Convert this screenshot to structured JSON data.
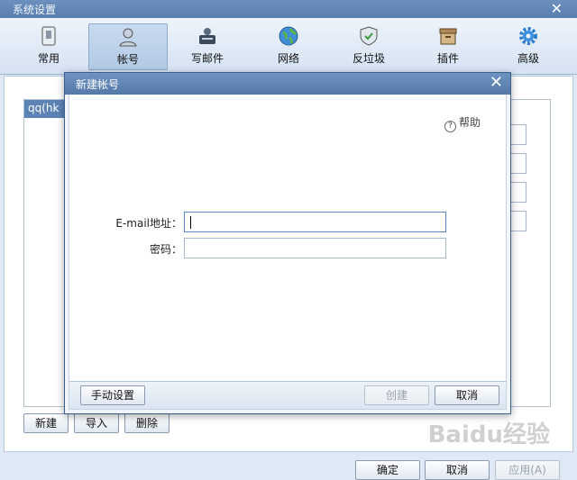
{
  "window": {
    "title": "系统设置",
    "close_symbol": "✕"
  },
  "toolbar": {
    "items": [
      {
        "label": "常用",
        "icon": "phone-icon"
      },
      {
        "label": "帐号",
        "icon": "user-icon",
        "active": true
      },
      {
        "label": "写邮件",
        "icon": "compose-icon"
      },
      {
        "label": "网络",
        "icon": "globe-icon"
      },
      {
        "label": "反垃圾",
        "icon": "shield-icon"
      },
      {
        "label": "插件",
        "icon": "box-icon"
      },
      {
        "label": "高级",
        "icon": "gear-icon"
      }
    ]
  },
  "accounts": {
    "items": [
      "qq(hk"
    ]
  },
  "account_buttons": {
    "new": "新建",
    "import": "导入",
    "delete": "删除"
  },
  "bottom_buttons": {
    "ok": "确定",
    "cancel": "取消",
    "apply": "应用(A)"
  },
  "dialog": {
    "title": "新建帐号",
    "close_symbol": "✕",
    "help": "帮助",
    "email_label": "E-mail地址：",
    "email_value": "",
    "password_label": "密码：",
    "password_value": "",
    "manual_button": "手动设置",
    "create_button": "创建",
    "cancel_button": "取消"
  },
  "watermark": "Baidu经验",
  "colors": {
    "accent": "#5c83b5",
    "titlebar": "#587fb0"
  }
}
